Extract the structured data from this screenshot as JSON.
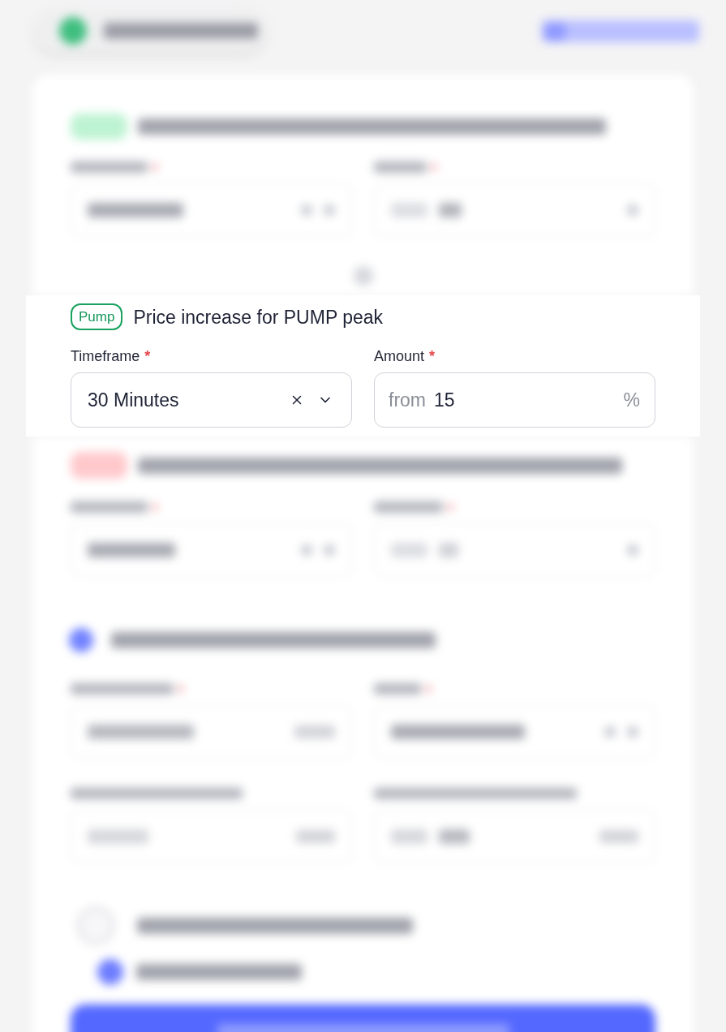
{
  "section": {
    "badge": "Pump",
    "title": "Price increase for PUMP peak",
    "fields": [
      {
        "kind": "select",
        "label": "Timeframe",
        "required_mark": "*",
        "value": "30 Minutes"
      },
      {
        "kind": "number",
        "label": "Amount",
        "required_mark": "*",
        "prefix": "from",
        "value": "15",
        "suffix": "%"
      }
    ]
  }
}
